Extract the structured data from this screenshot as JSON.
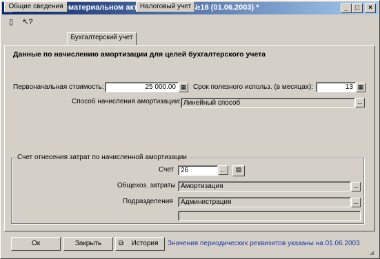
{
  "window": {
    "title": "Сведенияо нематериальном активе:Лицензия №18 (01.06.2003) *",
    "controls": {
      "minimize": "_",
      "maximize": "□",
      "close": "×"
    }
  },
  "toolbar": [
    {
      "name": "new-doc-icon",
      "glyph": "▯"
    },
    {
      "name": "help-cursor-icon",
      "glyph": "↖?"
    }
  ],
  "tabs": [
    {
      "label": "Общие сведения"
    },
    {
      "label": "Бухгалтерский учет"
    },
    {
      "label": "Налоговый учет"
    }
  ],
  "active_tab": 1,
  "section_heading": "Данные по начислению амортизации для целей бухгалтерского учета",
  "fields": {
    "initial_cost": {
      "label": "Первоначальная стоимость:",
      "value": "25 000.00"
    },
    "useful_life": {
      "label": "Срок полезного использ. (в месяцах):",
      "value": "13"
    },
    "method": {
      "label": "Способ начисления амортизации:",
      "value": "Линейный способ"
    }
  },
  "group": {
    "title": "Счет отнесения затрат по начисленной амортизации",
    "account": {
      "label": "Счет",
      "value": "26"
    },
    "expenses": {
      "label": "Общехоз. затраты",
      "value": "Амортизация"
    },
    "department": {
      "label": "Подразделения",
      "value": "Администрация"
    },
    "extra": {
      "value": ""
    }
  },
  "buttons": {
    "ok": "Ок",
    "close": "Закрыть",
    "history": "История"
  },
  "status_text": "Значения периодических реквизитов указаны на 01.06.2003",
  "colors": {
    "title_gradient_start": "#0a246a",
    "title_gradient_end": "#a6caf0",
    "face": "#d4d0c8",
    "status_link": "#1a3ca8"
  }
}
